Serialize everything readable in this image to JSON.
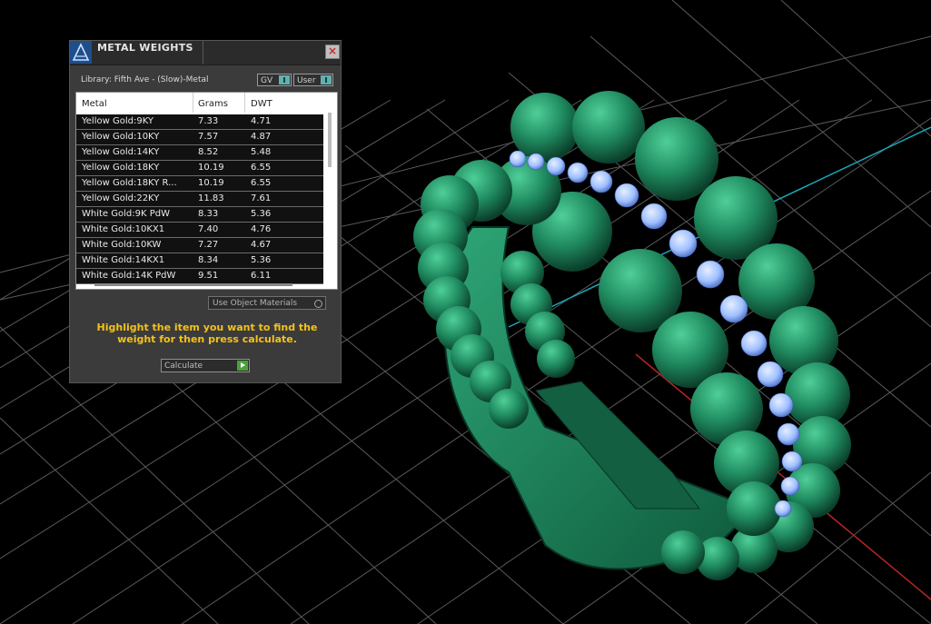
{
  "panel": {
    "title": "METAL WEIGHTS",
    "close_label": "×",
    "library_label": "Library: Fifth Ave - (Slow)-Metal",
    "toggles": {
      "gv": "GV",
      "user": "User"
    },
    "table": {
      "headers": [
        "Metal",
        "Grams",
        "DWT"
      ],
      "rows": [
        [
          "Yellow Gold:9KY",
          "7.33",
          "4.71"
        ],
        [
          "Yellow Gold:10KY",
          "7.57",
          "4.87"
        ],
        [
          "Yellow Gold:14KY",
          "8.52",
          "5.48"
        ],
        [
          "Yellow Gold:18KY",
          "10.19",
          "6.55"
        ],
        [
          "Yellow Gold:18KY R...",
          "10.19",
          "6.55"
        ],
        [
          "Yellow Gold:22KY",
          "11.83",
          "7.61"
        ],
        [
          "White Gold:9K PdW",
          "8.33",
          "5.36"
        ],
        [
          "White Gold:10KX1",
          "7.40",
          "4.76"
        ],
        [
          "White Gold:10KW",
          "7.27",
          "4.67"
        ],
        [
          "White Gold:14KX1",
          "8.34",
          "5.36"
        ],
        [
          "White Gold:14K PdW",
          "9.51",
          "6.11"
        ]
      ]
    },
    "use_materials_label": "Use Object Materials",
    "instruction": "Highlight the item you want to find the weight for then press calculate.",
    "calculate_label": "Calculate"
  },
  "colors": {
    "grid": "#5a5a5a",
    "ring_green": "#1f8a5f",
    "gem_blue": "#9fc0ff",
    "axis_red": "#b52525",
    "axis_cyan": "#1aa6b8",
    "instruction_yellow": "#f3c21a"
  }
}
